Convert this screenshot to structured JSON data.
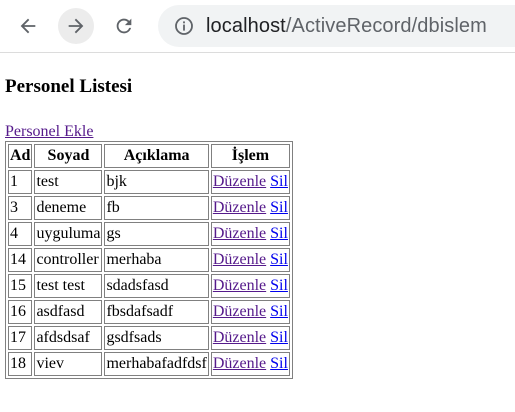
{
  "browser": {
    "url_host": "localhost",
    "url_path": "/ActiveRecord/dbislem",
    "icons": [
      "back-arrow-icon",
      "forward-arrow-icon",
      "reload-icon",
      "info-icon"
    ]
  },
  "page": {
    "title": "Personel Listesi",
    "add_link": "Personel Ekle"
  },
  "table": {
    "headers": [
      "Ad",
      "Soyad",
      "Açıklama",
      "İşlem"
    ],
    "rows": [
      {
        "id": "1",
        "soyad": "test",
        "aciklama": "bjk",
        "edit": "Düzenle",
        "delete": "Sil"
      },
      {
        "id": "3",
        "soyad": "deneme",
        "aciklama": "fb",
        "edit": "Düzenle",
        "delete": "Sil"
      },
      {
        "id": "4",
        "soyad": "uyguluma",
        "aciklama": "gs",
        "edit": "Düzenle",
        "delete": "Sil"
      },
      {
        "id": "14",
        "soyad": "controller",
        "aciklama": "merhaba",
        "edit": "Düzenle",
        "delete": "Sil"
      },
      {
        "id": "15",
        "soyad": "test test",
        "aciklama": "sdadsfasd",
        "edit": "Düzenle",
        "delete": "Sil"
      },
      {
        "id": "16",
        "soyad": "asdfasd",
        "aciklama": "fbsdafsadf",
        "edit": "Düzenle",
        "delete": "Sil"
      },
      {
        "id": "17",
        "soyad": "afdsdsaf",
        "aciklama": "gsdfsads",
        "edit": "Düzenle",
        "delete": "Sil"
      },
      {
        "id": "18",
        "soyad": "viev",
        "aciklama": "merhabafadfdsf",
        "edit": "Düzenle",
        "delete": "Sil"
      }
    ]
  },
  "colors": {
    "visited_link": "#551a8b",
    "link": "#0000ee"
  }
}
